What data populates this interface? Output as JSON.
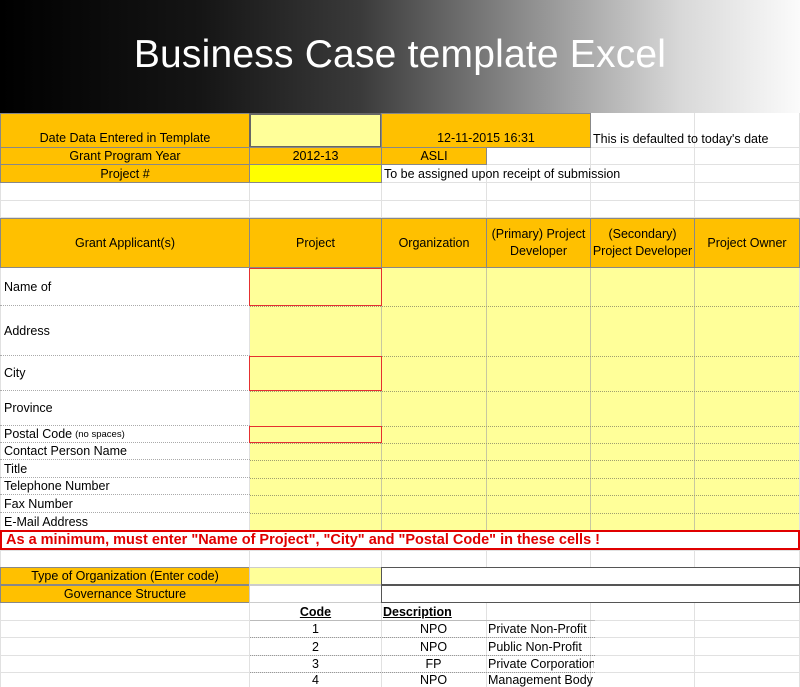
{
  "banner": {
    "title": "Business Case template Excel"
  },
  "top_rows": {
    "date_label": "Date Data Entered in Template",
    "date_value": "12-11-2015 16:31",
    "date_note": "This is defaulted to today's date",
    "grant_year_label": "Grant Program Year",
    "grant_year_value": "2012-13",
    "grant_year_extra": "ASLI",
    "project_num_label": "Project #",
    "project_num_note": "To be assigned upon receipt of submission"
  },
  "columns": {
    "applicant": "Grant Applicant(s)",
    "project": "Project",
    "organization": "Organization",
    "primary_developer": "(Primary) Project Developer",
    "secondary_developer": "(Secondary) Project Developer",
    "owner": "Project Owner"
  },
  "fields": {
    "name_of": "Name of",
    "address": "Address",
    "city": "City",
    "province": "Province",
    "postal_code": "Postal Code",
    "postal_code_note": "(no spaces)",
    "contact_person": "Contact Person Name",
    "title": "Title",
    "telephone": "Telephone Number",
    "fax": "Fax Number",
    "email": "E-Mail Address"
  },
  "warning": "As a minimum, must enter \"Name of Project\", \"City\" and \"Postal Code\" in these cells !",
  "org": {
    "type_label": "Type of Organization (Enter code)",
    "governance_label": "Governance Structure"
  },
  "code_table": {
    "code_header": "Code",
    "description_header": "Description",
    "rows": [
      {
        "num": "1",
        "abbr": "NPO",
        "desc": "Private Non-Profit"
      },
      {
        "num": "2",
        "abbr": "NPO",
        "desc": "Public Non-Profit"
      },
      {
        "num": "3",
        "abbr": "FP",
        "desc": "Private Corporation"
      },
      {
        "num": "4",
        "abbr": "NPO",
        "desc": "Management Body"
      }
    ]
  },
  "colors": {
    "header_orange": "#ffc000",
    "input_yellow": "#ffff99",
    "warning_red": "#e00000"
  }
}
